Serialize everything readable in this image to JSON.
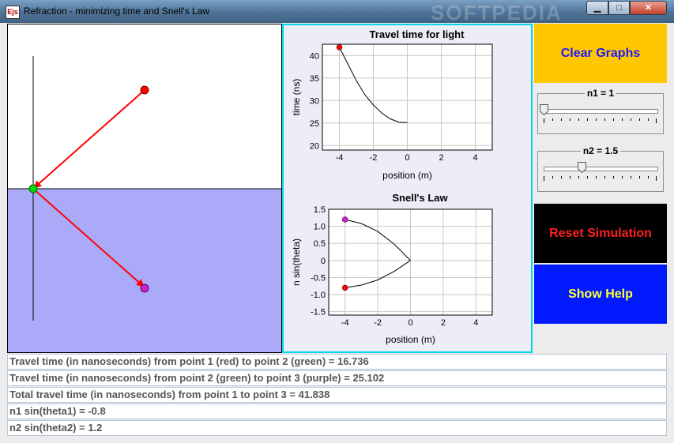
{
  "window": {
    "title": "Refraction - minimizing time and Snell's Law",
    "icon_label": "Ejs",
    "watermark": "SOFTPEDIA",
    "buttons": {
      "minimize": "▁",
      "maximize": "□",
      "close": "✕"
    }
  },
  "simulation": {
    "colors": {
      "medium1": "#ffffff",
      "medium2": "#aaaaf8",
      "ray": "#ff0000",
      "point1": "#ff0000",
      "point2": "#00dd00",
      "point3": "#cc22cc"
    }
  },
  "chart_data": [
    {
      "type": "line",
      "title": "Travel time for light",
      "xlabel": "position (m)",
      "ylabel": "time (ns)",
      "xlim": [
        -5,
        5
      ],
      "ylim": [
        19,
        42.5
      ],
      "xticks": [
        -4,
        -2,
        0,
        2,
        4
      ],
      "yticks": [
        20,
        25,
        30,
        35,
        40
      ],
      "grid": true,
      "series": [
        {
          "x": [
            -4,
            -3.5,
            -3,
            -2.5,
            -2,
            -1.5,
            -1,
            -0.5,
            0
          ],
          "y": [
            41.84,
            38.1,
            34.4,
            31.3,
            29.0,
            27.2,
            25.9,
            25.2,
            25.1
          ]
        }
      ],
      "markers": [
        {
          "x": -4,
          "y": 41.84,
          "color": "#ff0000"
        }
      ]
    },
    {
      "type": "line",
      "title": "Snell's Law",
      "xlabel": "position (m)",
      "ylabel": "n sin(theta)",
      "xlim": [
        -5,
        5
      ],
      "ylim": [
        -1.6,
        1.5
      ],
      "xticks": [
        -4,
        -2,
        0,
        2,
        4
      ],
      "yticks": [
        1.5,
        1.0,
        0.5,
        0,
        -0.5,
        -1.0,
        -1.5
      ],
      "ytick_labels": [
        "1.5",
        "1.0",
        "0.5",
        "0",
        "-0.5",
        "-1.0",
        "-1.5"
      ],
      "grid": true,
      "series": [
        {
          "x": [
            -4,
            -3,
            -2,
            -1,
            0
          ],
          "y": [
            1.2,
            1.08,
            0.85,
            0.48,
            0
          ]
        },
        {
          "x": [
            -4,
            -3,
            -2,
            -1,
            0
          ],
          "y": [
            -0.8,
            -0.72,
            -0.57,
            -0.32,
            0
          ]
        }
      ],
      "markers": [
        {
          "x": -4,
          "y": 1.2,
          "color": "#cc22cc"
        },
        {
          "x": -4,
          "y": -0.8,
          "color": "#ff0000"
        }
      ]
    }
  ],
  "controls": {
    "clear_graphs": "Clear Graphs",
    "n1": {
      "label": "n1 = 1",
      "value": 1
    },
    "n2": {
      "label": "n2 = 1.5",
      "value": 1.5
    },
    "reset_simulation": "Reset Simulation",
    "show_help": "Show Help"
  },
  "info_lines": [
    "Travel time (in nanoseconds) from point 1 (red) to point 2 (green) = 16.736",
    "Travel time (in nanoseconds) from point 2 (green) to point 3 (purple) = 25.102",
    "Total travel time (in nanoseconds) from point 1 to point 3 = 41.838",
    "n1 sin(theta1) = -0.8",
    "n2 sin(theta2) = 1.2"
  ]
}
